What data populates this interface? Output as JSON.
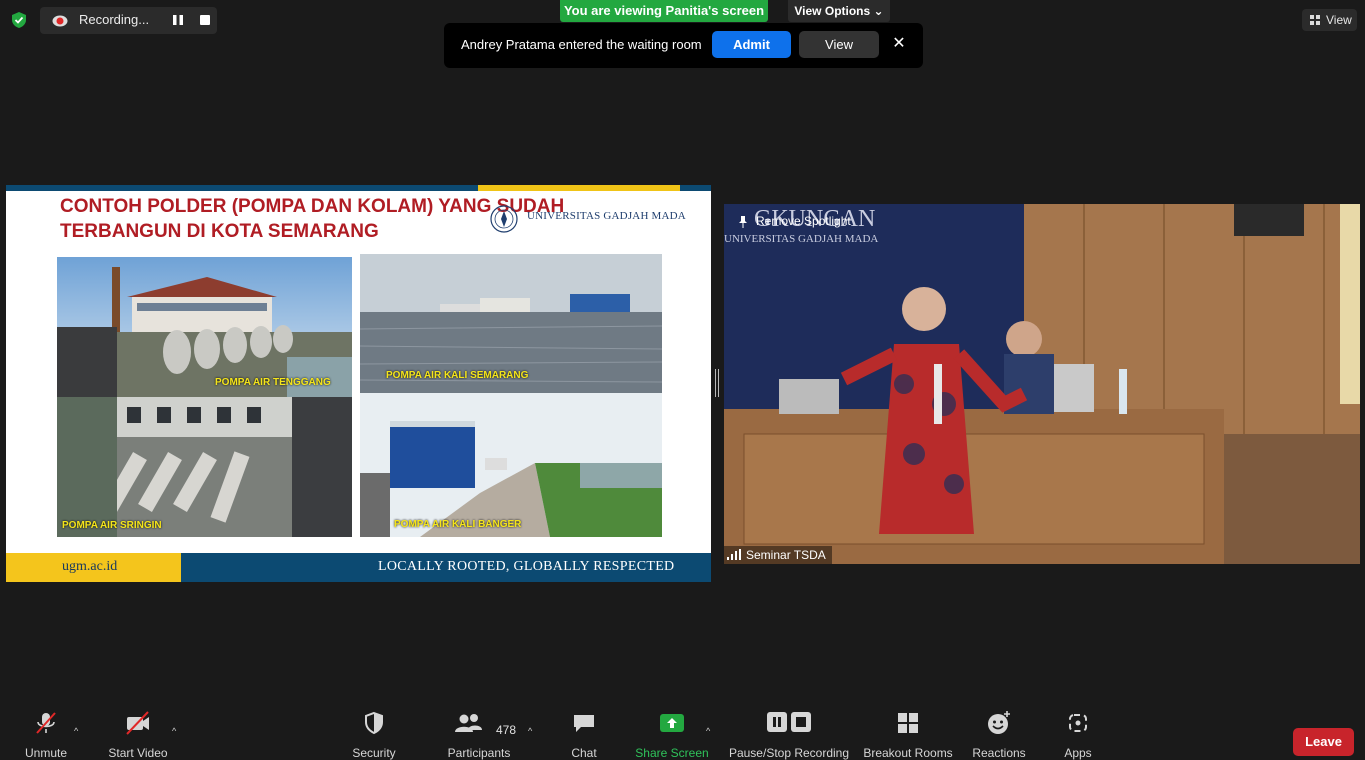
{
  "top": {
    "recording_label": "Recording...",
    "viewing_banner": "You are viewing Panitia's screen",
    "view_options": "View Options",
    "view_label": "View"
  },
  "waiting_room": {
    "message": "Andrey Pratama entered the waiting room",
    "admit": "Admit",
    "view": "View",
    "close": "✕"
  },
  "slide": {
    "title_line1": "CONTOH POLDER (POMPA DAN KOLAM) YANG SUDAH",
    "title_line2": "TERBANGUN DI KOTA SEMARANG",
    "university": "UNIVERSITAS GADJAH MADA",
    "photos": [
      {
        "caption": "POMPA AIR TENGGANG"
      },
      {
        "caption": "POMPA AIR KALI SEMARANG"
      },
      {
        "caption": "POMPA AIR SRINGIN"
      },
      {
        "caption": "POMPA AIR KALI BANGER"
      }
    ],
    "footer_url": "ugm.ac.id",
    "footer_motto": "LOCALLY ROOTED, GLOBALLY RESPECTED"
  },
  "video": {
    "remove_spotlight": "Remove Spotlight",
    "participant_name": "Seminar TSDA",
    "bg_sign1": "GKUNGAN",
    "bg_sign2": "UNIVERSITAS GADJAH MADA"
  },
  "toolbar": {
    "unmute": "Unmute",
    "start_video": "Start Video",
    "security": "Security",
    "participants": "Participants",
    "participants_count": "478",
    "chat": "Chat",
    "share_screen": "Share Screen",
    "pause_stop_recording": "Pause/Stop Recording",
    "breakout_rooms": "Breakout Rooms",
    "reactions": "Reactions",
    "apps": "Apps",
    "leave": "Leave"
  },
  "colors": {
    "accent_blue": "#0e71eb",
    "share_green": "#23a840",
    "leave_red": "#c8242b",
    "ugm_navy": "#0c4a72",
    "ugm_gold": "#f4c51c"
  }
}
